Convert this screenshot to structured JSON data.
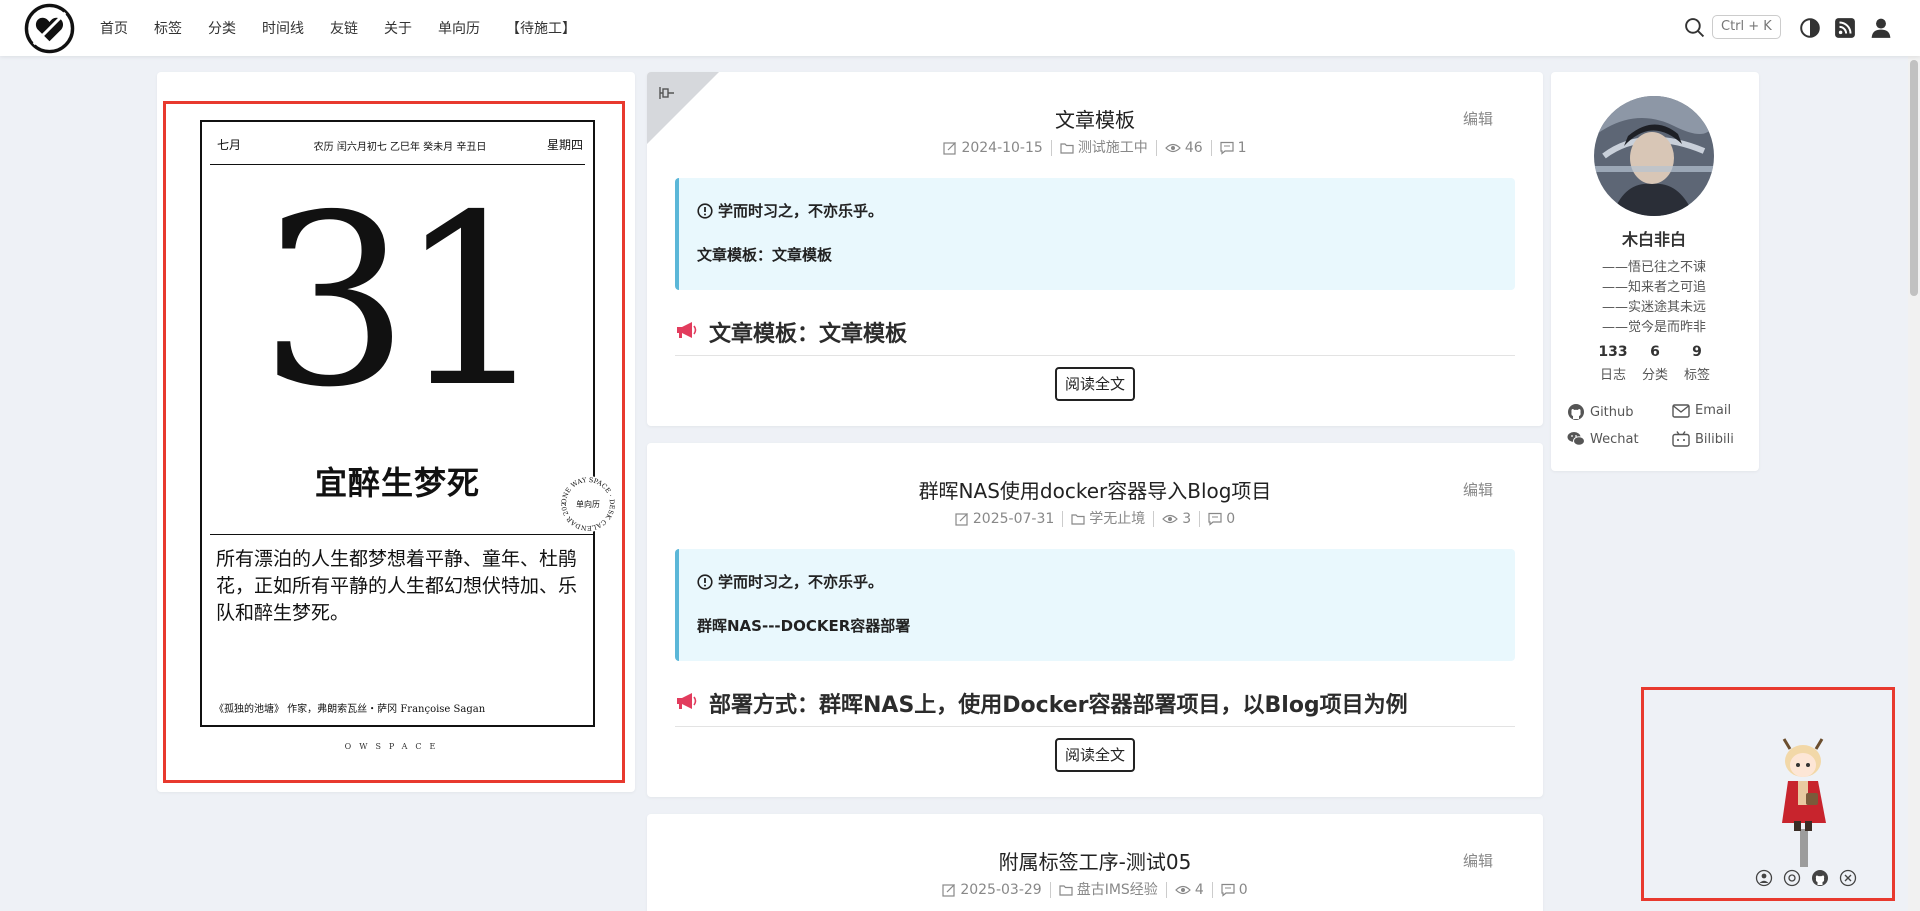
{
  "nav": {
    "links": [
      "首页",
      "标签",
      "分类",
      "时间线",
      "友链",
      "关于",
      "单向历",
      "【待施工】"
    ],
    "search_shortcut": "Ctrl + K"
  },
  "calendar": {
    "month": "七月",
    "lunar": "农历 闰六月初七 乙巳年 癸未月 辛丑日",
    "weekday": "星期四",
    "day": "31",
    "yi": "宜醉生梦死",
    "quote": "所有漂泊的人生都梦想着平静、童年、杜鹃花，正如所有平静的人生都幻想伏特加、乐队和醉生梦死。",
    "source": "《孤独的池塘》 作家，弗朗索瓦丝・萨冈    Françoise Sagan",
    "stamp_text": "ONE WAY SPACE · DESK CALENDAR 2025",
    "stamp_center": "单向历",
    "brand": "OWSPACE"
  },
  "posts": [
    {
      "title": "文章模板",
      "edit": "编辑",
      "date": "2024-10-15",
      "category": "测试施工中",
      "views": "46",
      "comments": "1",
      "notice_title": "学而时习之，不亦乐乎。",
      "notice_body": "文章模板：文章模板",
      "heading": "文章模板：文章模板",
      "read_more": "阅读全文"
    },
    {
      "title": "群晖NAS使用docker容器导入Blog项目",
      "edit": "编辑",
      "date": "2025-07-31",
      "category": "学无止境",
      "views": "3",
      "comments": "0",
      "notice_title": "学而时习之，不亦乐乎。",
      "notice_body": "群晖NAS---DOCKER容器部署",
      "heading": "部署方式：群晖NAS上，使用Docker容器部署项目，以Blog项目为例",
      "read_more": "阅读全文"
    },
    {
      "title": "附属标签工序-测试05",
      "edit": "编辑",
      "date": "2025-03-29",
      "category": "盘古IMS经验",
      "views": "4",
      "comments": "0"
    }
  ],
  "profile": {
    "name": "木白非白",
    "motto": [
      "——悟已往之不谏",
      "——知来者之可追",
      "——实迷途其未远",
      "——觉今是而昨非"
    ],
    "stats": [
      {
        "num": "133",
        "label": "日志"
      },
      {
        "num": "6",
        "label": "分类"
      },
      {
        "num": "9",
        "label": "标签"
      }
    ],
    "social": [
      "Github",
      "Email",
      "Wechat",
      "Bilibili"
    ]
  },
  "colors": {
    "accent": "#e8392e",
    "notice_bg": "#e9f8fd",
    "notice_border": "#5bb7d8",
    "page_bg": "#eef1f6"
  }
}
